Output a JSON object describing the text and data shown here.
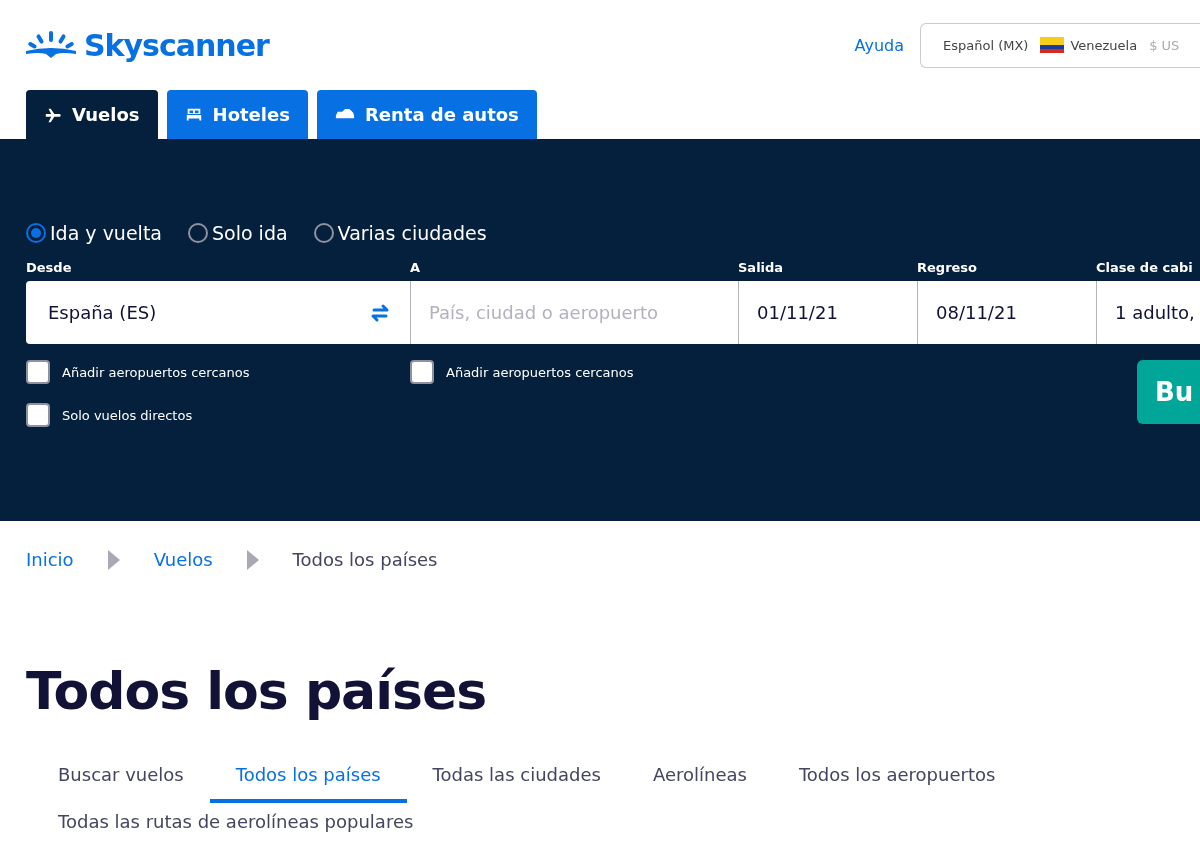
{
  "header": {
    "logo": "Skyscanner",
    "help_link": "Ayuda",
    "locale": {
      "language": "Español (MX)",
      "country": "Venezuela",
      "currency": "$ US"
    }
  },
  "product_tabs": [
    {
      "label": "Vuelos",
      "kind": "plane",
      "selected": true
    },
    {
      "label": "Hoteles",
      "kind": "bed",
      "selected": false
    },
    {
      "label": "Renta de autos",
      "kind": "car",
      "selected": false
    }
  ],
  "search": {
    "trip_types": [
      {
        "label": "Ida y vuelta",
        "selected": true
      },
      {
        "label": "Solo ida",
        "selected": false
      },
      {
        "label": "Varias ciudades",
        "selected": false
      }
    ],
    "fields": [
      {
        "label": "Desde",
        "value": "España (ES)",
        "kind": "origin"
      },
      {
        "label": "A",
        "placeholder": "País, ciudad o aeropuerto",
        "kind": "destination"
      },
      {
        "label": "Salida",
        "value": "01/11/21",
        "kind": "date"
      },
      {
        "label": "Regreso",
        "value": "08/11/21",
        "kind": "date"
      },
      {
        "label": "Clase de cabi",
        "value": "1 adulto,",
        "kind": "travellers"
      }
    ],
    "origin_options": [
      {
        "label": "Añadir aeropuertos cercanos",
        "checked": false
      },
      {
        "label": "Solo vuelos directos",
        "checked": false
      }
    ],
    "destination_options": [
      {
        "label": "Añadir aeropuertos cercanos",
        "checked": false
      }
    ],
    "search_button": "Bu"
  },
  "breadcrumb": [
    {
      "label": "Inicio",
      "kind": "link"
    },
    {
      "label": "Vuelos",
      "kind": "link"
    },
    {
      "label": "Todos los países",
      "kind": "current"
    }
  ],
  "page_title": "Todos los países",
  "subnav": [
    {
      "label": "Buscar vuelos",
      "selected": false
    },
    {
      "label": "Todos los países",
      "selected": true
    },
    {
      "label": "Todas las ciudades",
      "selected": false
    },
    {
      "label": "Aerolíneas",
      "selected": false
    },
    {
      "label": "Todos los aeropuertos",
      "selected": false
    },
    {
      "label": "Todas las rutas de aerolíneas populares",
      "selected": false
    }
  ]
}
